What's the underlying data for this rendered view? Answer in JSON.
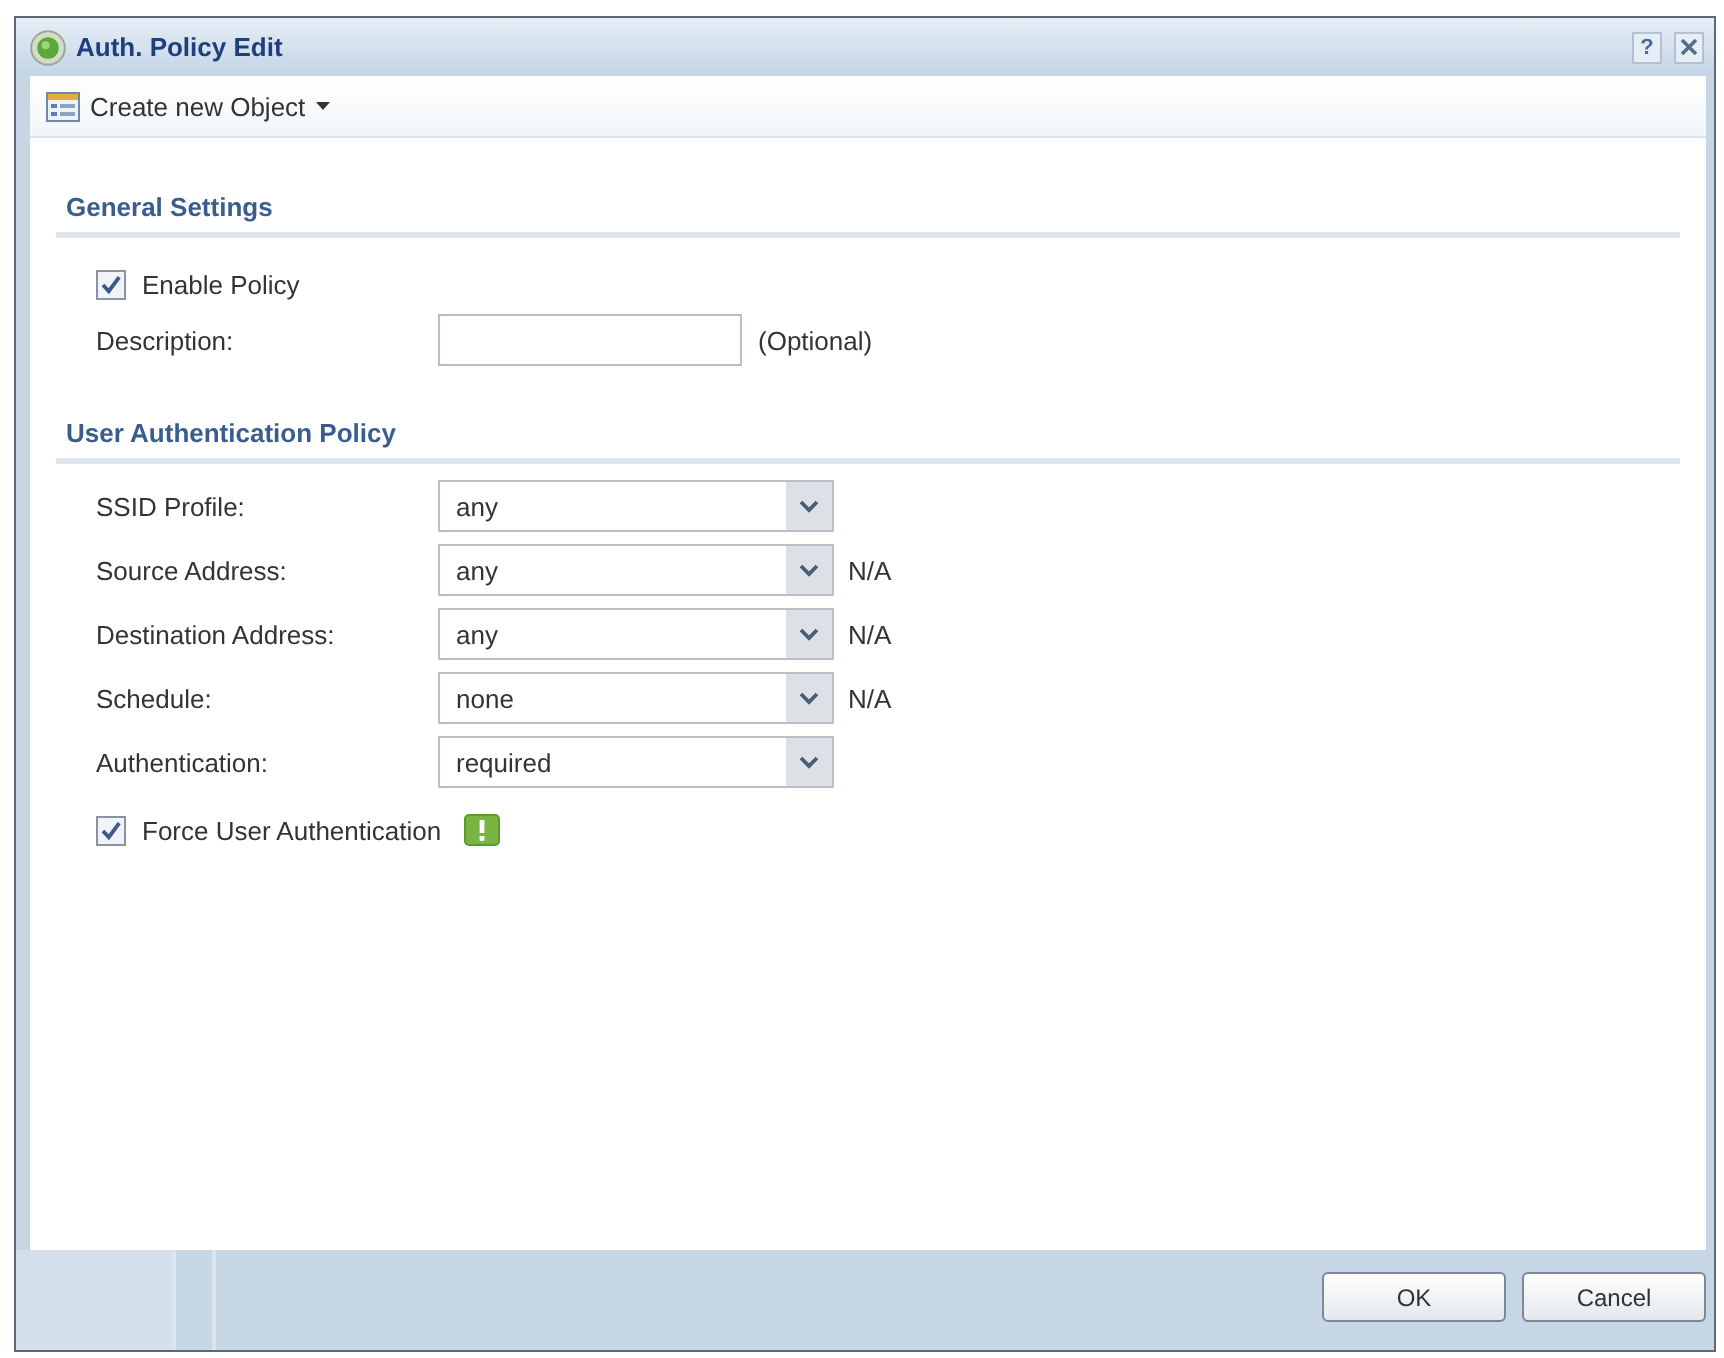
{
  "window": {
    "title": "Auth. Policy Edit",
    "help_label": "?"
  },
  "toolbar": {
    "menu_button": "Create new Object"
  },
  "sections": [
    {
      "title": "General Settings",
      "fields": [
        {
          "kind": "checkbox",
          "label": "Enable Policy",
          "checked": true,
          "notice": false
        },
        {
          "kind": "text",
          "label": "Description:",
          "note": "(Optional)"
        }
      ]
    },
    {
      "title": "User Authentication Policy",
      "fields": [
        {
          "kind": "select",
          "label": "SSID Profile:",
          "value": "any"
        },
        {
          "kind": "select",
          "label": "Source Address:",
          "value": "any",
          "note": "N/A"
        },
        {
          "kind": "select",
          "label": "Destination Address:",
          "value": "any",
          "note": "N/A"
        },
        {
          "kind": "select",
          "label": "Schedule:",
          "value": "none",
          "note": "N/A"
        },
        {
          "kind": "select",
          "label": "Authentication:",
          "value": "required"
        },
        {
          "kind": "checkbox",
          "label": "Force User Authentication",
          "checked": true,
          "notice": true
        }
      ]
    }
  ],
  "buttons": [
    {
      "label": "OK"
    },
    {
      "label": "Cancel"
    }
  ]
}
